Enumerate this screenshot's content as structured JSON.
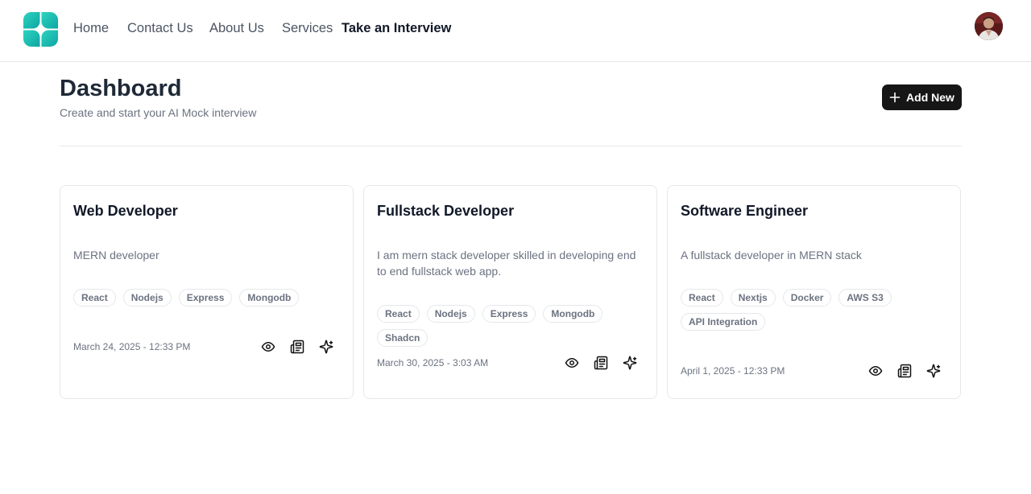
{
  "nav": {
    "items": [
      {
        "label": "Home"
      },
      {
        "label": "Contact Us"
      },
      {
        "label": "About Us"
      },
      {
        "label": "Services"
      },
      {
        "label": "Take an Interview"
      }
    ]
  },
  "dashboard": {
    "title": "Dashboard",
    "subtitle": "Create and start your AI Mock interview",
    "add_button_label": "Add New"
  },
  "colors": {
    "logo_teal": "#14b8a6",
    "button_bg": "#161616"
  },
  "cards": [
    {
      "title": "Web Developer",
      "description": "MERN developer",
      "tags": [
        "React",
        "Nodejs",
        "Express",
        "Mongodb"
      ],
      "date": "March 24, 2025 - 12:33 PM",
      "actions": [
        "eye-icon",
        "newspaper-icon",
        "sparkles-icon"
      ]
    },
    {
      "title": "Fullstack Developer",
      "description": "I am mern stack developer skilled in developing end to end fullstack web app.",
      "tags": [
        "React",
        "Nodejs",
        "Express",
        "Mongodb",
        "Shadcn"
      ],
      "date": "March 30, 2025 - 3:03 AM",
      "actions": [
        "eye-icon",
        "newspaper-icon",
        "sparkles-icon"
      ]
    },
    {
      "title": "Software Engineer",
      "description": "A fullstack developer in MERN stack",
      "tags": [
        "React",
        "Nextjs",
        "Docker",
        "AWS S3",
        "API Integration"
      ],
      "date": "April 1, 2025 - 12:33 PM",
      "actions": [
        "eye-icon",
        "newspaper-icon",
        "sparkles-icon"
      ]
    }
  ]
}
